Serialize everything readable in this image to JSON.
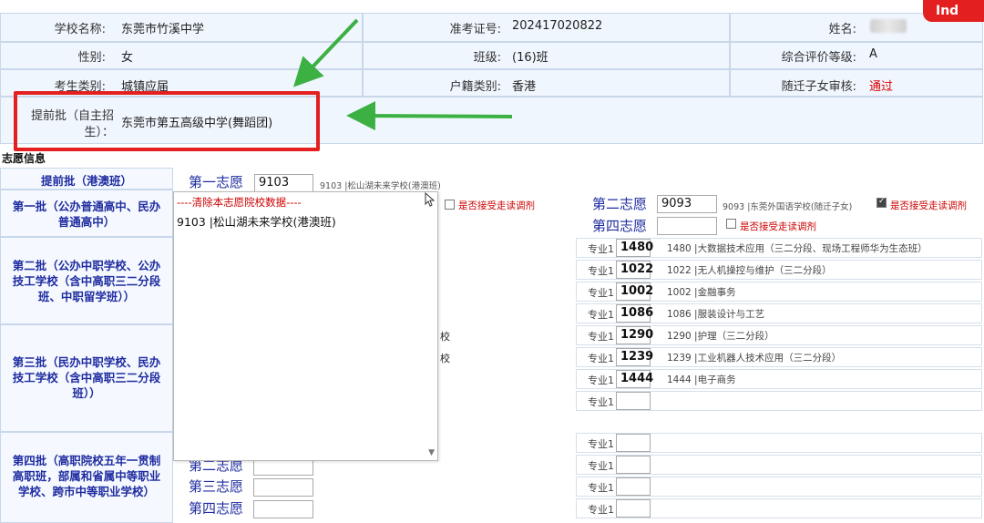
{
  "student_info": {
    "school_name_label": "学校名称:",
    "school_name": "东莞市竹溪中学",
    "exam_no_label": "准考证号:",
    "exam_no": "202417020822",
    "name_label": "姓名:",
    "gender_label": "性别:",
    "gender": "女",
    "class_label": "班级:",
    "class": "(16)班",
    "eval_label": "综合评价等级:",
    "eval": "A",
    "category_label": "考生类别:",
    "category": "城镇应届",
    "hukou_label": "户籍类别:",
    "hukou": "香港",
    "migrant_label": "随迁子女审核:",
    "migrant": "通过",
    "early_label_1": "提前批（自主招",
    "early_label_2": "生）：",
    "early_value": "东莞市第五高级中学(舞蹈团)"
  },
  "section": {
    "title": "志愿信息"
  },
  "batches": [
    {
      "label": "提前批（港澳班）"
    },
    {
      "label_1": "第一批（公办普通高中、民办",
      "label_2": "普通高中）"
    },
    {
      "label_1": "第二批（公办中职学校、公办",
      "label_2": "技工学校（含中高职三二分段",
      "label_3": "班、中职留学班））"
    },
    {
      "label_1": "第三批（民办中职学校、民办",
      "label_2": "技工学校（含中高职三二分段",
      "label_3": "班））"
    },
    {
      "label_1": "第四批（高职院校五年一贯制",
      "label_2": "高职班，部属和省属中等职业",
      "label_3": "学校、跨市中等职业学校）"
    }
  ],
  "choices": {
    "first": "第一志愿",
    "second": "第二志愿",
    "third": "第三志愿",
    "fourth": "第四志愿",
    "hk_first_code": "9103",
    "hk_first_desc": "9103 |松山湖未来学校(港澳班)",
    "b1_second_code": "9093",
    "b1_second_desc": "9093 |东莞外国语学校(随迁子女)",
    "accept_adjust": "是否接受走读调剂",
    "b1_second_checked": true,
    "b1_fourth_checked": false,
    "b1_first_checked": false
  },
  "dropdown": {
    "clear": "----清除本志愿院校数据----",
    "option": "9103 |松山湖未来学校(港澳班)"
  },
  "partial_text": {
    "p1": "校",
    "p2": "校"
  },
  "specialties": {
    "label": "专业1",
    "rows": [
      {
        "code": "1480",
        "desc": "1480 |大数据技术应用（三二分段、现场工程师华为生态班）"
      },
      {
        "code": "1022",
        "desc": "1022 |无人机操控与维护（三二分段）"
      },
      {
        "code": "1002",
        "desc": "1002 |金融事务"
      },
      {
        "code": "1086",
        "desc": "1086 |服装设计与工艺"
      },
      {
        "code": "1290",
        "desc": "1290 |护理（三二分段）"
      },
      {
        "code": "1239",
        "desc": "1239 |工业机器人技术应用（三二分段）"
      },
      {
        "code": "1444",
        "desc": "1444 |电子商务"
      },
      {
        "code": "",
        "desc": ""
      },
      {
        "code": "",
        "desc": ""
      },
      {
        "code": "",
        "desc": ""
      },
      {
        "code": "",
        "desc": ""
      },
      {
        "code": "",
        "desc": ""
      }
    ]
  },
  "overlay": {
    "corner_text": "Ind"
  },
  "colors": {
    "annotation_red": "#e3201f",
    "arrow_green": "#3cb043",
    "batch_blue": "#1f2ca0",
    "bg_blue": "#f0f6fe"
  }
}
